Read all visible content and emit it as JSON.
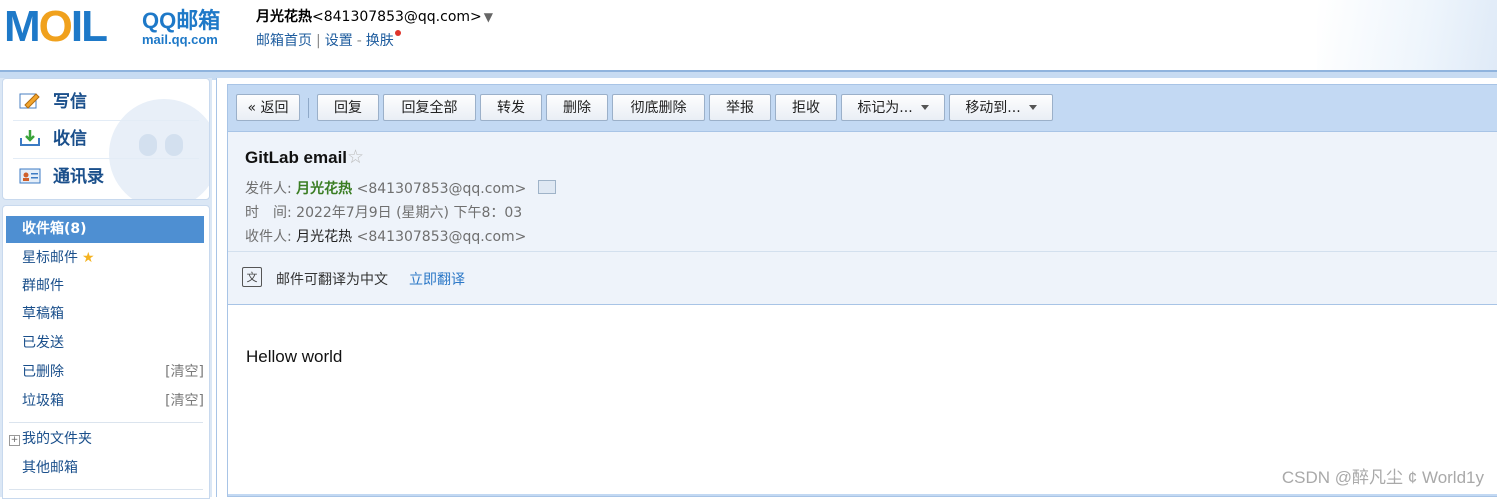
{
  "header": {
    "logo_text": "MOIL",
    "logo_brand": "QQ邮箱",
    "logo_domain": "mail.qq.com",
    "account_name": "月光花热",
    "account_email": "<841307853@qq.com>",
    "links": [
      "邮箱首页",
      "设置",
      "换肤"
    ]
  },
  "sidebar": {
    "quick": [
      {
        "label": "写信",
        "icon": "pencil-icon"
      },
      {
        "label": "收信",
        "icon": "inbox-download-icon"
      },
      {
        "label": "通讯录",
        "icon": "contact-card-icon"
      }
    ],
    "folders": {
      "inbox": "收件箱(8)",
      "starred": "星标邮件",
      "group": "群邮件",
      "drafts": "草稿箱",
      "sent": "已发送",
      "deleted": "已删除",
      "spam": "垃圾箱",
      "clear": "[清空]",
      "my_folders": "我的文件夹",
      "other": "其他邮箱"
    }
  },
  "toolbar": {
    "back": "« 返回",
    "reply": "回复",
    "reply_all": "回复全部",
    "forward": "转发",
    "delete": "删除",
    "delete_perm": "彻底删除",
    "report": "举报",
    "reject": "拒收",
    "mark_as": "标记为...",
    "move_to": "移动到..."
  },
  "email": {
    "subject": "GitLab email",
    "from_label": "发件人:",
    "from_name": "月光花热",
    "from_email": "<841307853@qq.com>",
    "time_label": "时　间:",
    "time_value": "2022年7月9日 (星期六) 下午8：03",
    "to_label": "收件人:",
    "to_name": "月光花热",
    "to_email": "<841307853@qq.com>",
    "body": "Hellow world"
  },
  "translate": {
    "text": "邮件可翻译为中文",
    "link": "立即翻译"
  },
  "watermark": "CSDN @醉凡尘 ¢ World1y"
}
